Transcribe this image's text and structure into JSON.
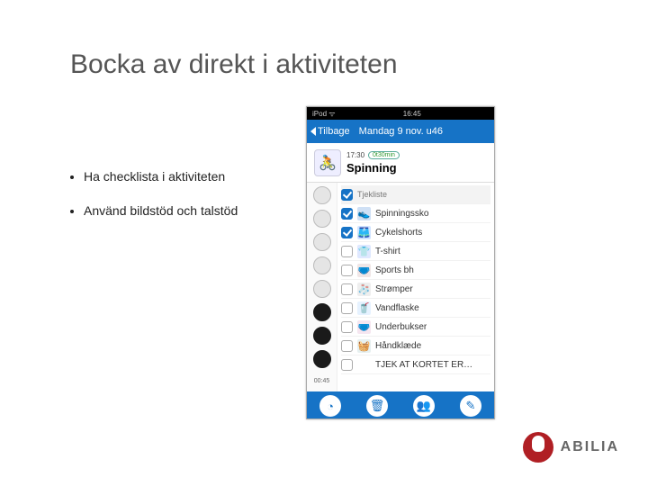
{
  "slide": {
    "title": "Bocka av direkt i aktiviteten",
    "bullets": [
      "Ha checklista i aktiviteten",
      "Använd bildstöd och talstöd"
    ]
  },
  "phone": {
    "status": {
      "left": "iPod ᯤ",
      "time": "16:45"
    },
    "nav": {
      "back": "Tilbage",
      "title": "Mandag 9 nov. u46"
    },
    "activity": {
      "time": "17:30",
      "duration": "0t30min",
      "title": "Spinning"
    },
    "checklist_header": "Tjekliste",
    "items": [
      {
        "checked": true,
        "icon": "👟",
        "bg": "#cfe0f5",
        "label": "Spinningssko"
      },
      {
        "checked": true,
        "icon": "🩳",
        "bg": "#d0e4ff",
        "label": "Cykelshorts"
      },
      {
        "checked": false,
        "icon": "👕",
        "bg": "#dfe8ff",
        "label": "T-shirt"
      },
      {
        "checked": false,
        "icon": "🩲",
        "bg": "#f0e6e6",
        "label": "Sports bh"
      },
      {
        "checked": false,
        "icon": "🧦",
        "bg": "#eee",
        "label": "Strømper"
      },
      {
        "checked": false,
        "icon": "🥤",
        "bg": "#e6f2ff",
        "label": "Vandflaske"
      },
      {
        "checked": false,
        "icon": "🩲",
        "bg": "#f5e6f0",
        "label": "Underbukser"
      },
      {
        "checked": false,
        "icon": "🧺",
        "bg": "#e6f0f0",
        "label": "Håndklæde"
      },
      {
        "checked": false,
        "icon": "",
        "bg": "#fff",
        "label": "TJEK AT KORTET ER…"
      }
    ],
    "dots": [
      false,
      false,
      false,
      false,
      false,
      true,
      true,
      true
    ],
    "dots_label": "00:45"
  },
  "brand": "ABILIA"
}
